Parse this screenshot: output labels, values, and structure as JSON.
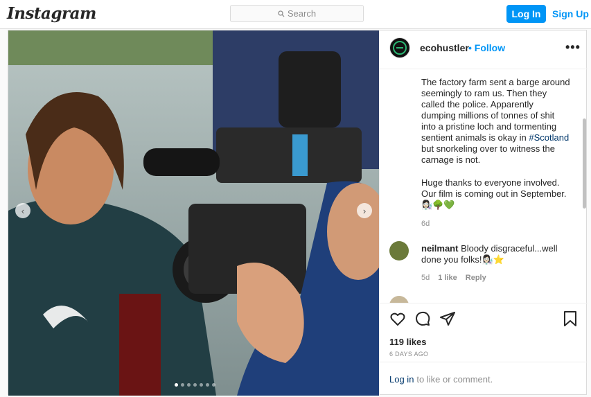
{
  "header": {
    "logo": "Instagram",
    "search_placeholder": "Search",
    "login_label": "Log In",
    "signup_label": "Sign Up"
  },
  "post": {
    "author": "ecohustler",
    "separator": "•",
    "follow_label": "Follow",
    "more_label": "•••",
    "carousel": {
      "slides": 7,
      "current": 1
    },
    "caption_p1_pre": "The factory farm sent a barge around seemingly to ram us. Then they called the police. Apparently dumping millions of tonnes of shit into a pristine loch and tormenting sentient animals is okay in ",
    "caption_hashtag": "#Scotland",
    "caption_p1_post": " but snorkeling over to witness the carnage is not.",
    "caption_p2": "Huge thanks to everyone involved. Our film is coming out in September.",
    "caption_emoji": "👩🏻‍🔬🌳💚",
    "caption_time": "6d",
    "comments": [
      {
        "user": "neilmant",
        "text": "Bloody disgraceful...well done you folks!",
        "emoji": "👩🏻‍🔬⭐",
        "time": "5d",
        "likes": "1 like",
        "reply": "Reply"
      }
    ],
    "likes": "119 likes",
    "posted_ago": "6 DAYS AGO",
    "login_link": "Log in",
    "login_suffix": "to like or comment."
  },
  "icons": [
    "search-icon",
    "heart-icon",
    "comment-icon",
    "share-icon",
    "bookmark-icon",
    "chevron-left-icon",
    "chevron-right-icon"
  ],
  "colors": {
    "accent": "#0095f6",
    "link": "#00376b",
    "muted": "#8e8e8e",
    "text": "#262626"
  }
}
